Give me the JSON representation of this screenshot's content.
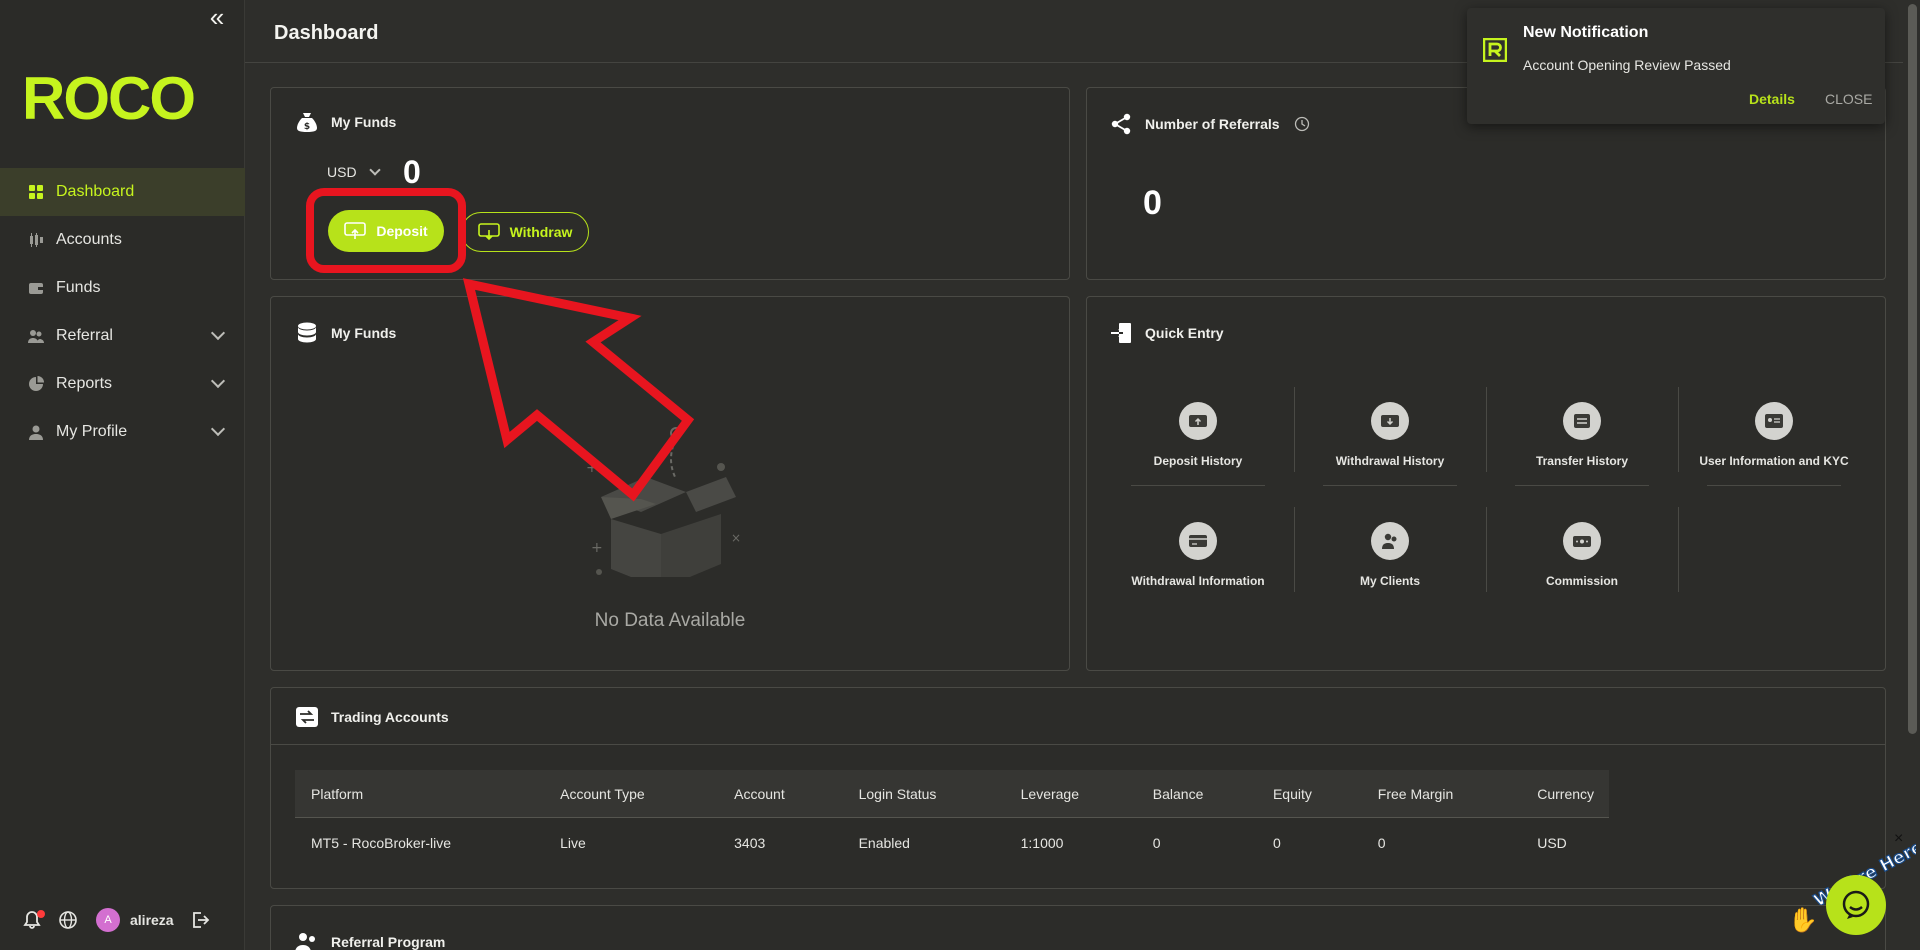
{
  "app": {
    "brand": "ROCO"
  },
  "sidebar": {
    "items": [
      {
        "label": "Dashboard",
        "active": true
      },
      {
        "label": "Accounts"
      },
      {
        "label": "Funds"
      },
      {
        "label": "Referral",
        "expandable": true
      },
      {
        "label": "Reports",
        "expandable": true
      },
      {
        "label": "My Profile",
        "expandable": true
      }
    ],
    "footer": {
      "avatar_initial": "A",
      "username": "alireza"
    }
  },
  "header": {
    "title": "Dashboard"
  },
  "funds_card": {
    "title": "My Funds",
    "currency": "USD",
    "value": "0",
    "deposit_label": "Deposit",
    "withdraw_label": "Withdraw"
  },
  "referrals_card": {
    "title": "Number of Referrals",
    "value": "0"
  },
  "funds_chart_card": {
    "title": "My Funds",
    "empty_text": "No Data Available"
  },
  "quick_entry": {
    "title": "Quick Entry",
    "items": [
      {
        "label": "Deposit History",
        "icon": "deposit-icon"
      },
      {
        "label": "Withdrawal History",
        "icon": "withdrawal-icon"
      },
      {
        "label": "Transfer History",
        "icon": "transfer-icon"
      },
      {
        "label": "User Information and KYC",
        "icon": "id-card-icon"
      },
      {
        "label": "Withdrawal Information",
        "icon": "card-icon"
      },
      {
        "label": "My Clients",
        "icon": "clients-icon"
      },
      {
        "label": "Commission",
        "icon": "commission-icon"
      }
    ]
  },
  "trading_accounts": {
    "title": "Trading Accounts",
    "columns": [
      "Platform",
      "Account Type",
      "Account",
      "Login Status",
      "Leverage",
      "Balance",
      "Equity",
      "Free Margin",
      "Currency"
    ],
    "rows": [
      [
        "MT5 - RocoBroker-live",
        "Live",
        "3403",
        "Enabled",
        "1:1000",
        "0",
        "0",
        "0",
        "USD"
      ]
    ]
  },
  "referral_program": {
    "title": "Referral Program"
  },
  "notification": {
    "title": "New Notification",
    "message": "Account Opening Review Passed",
    "details_label": "Details",
    "close_label": "CLOSE"
  },
  "chat": {
    "banner": "We Are Here!",
    "close": "×"
  },
  "colors": {
    "accent": "#b7e21a",
    "highlight": "#e8151f",
    "background": "#2e2e2b"
  }
}
